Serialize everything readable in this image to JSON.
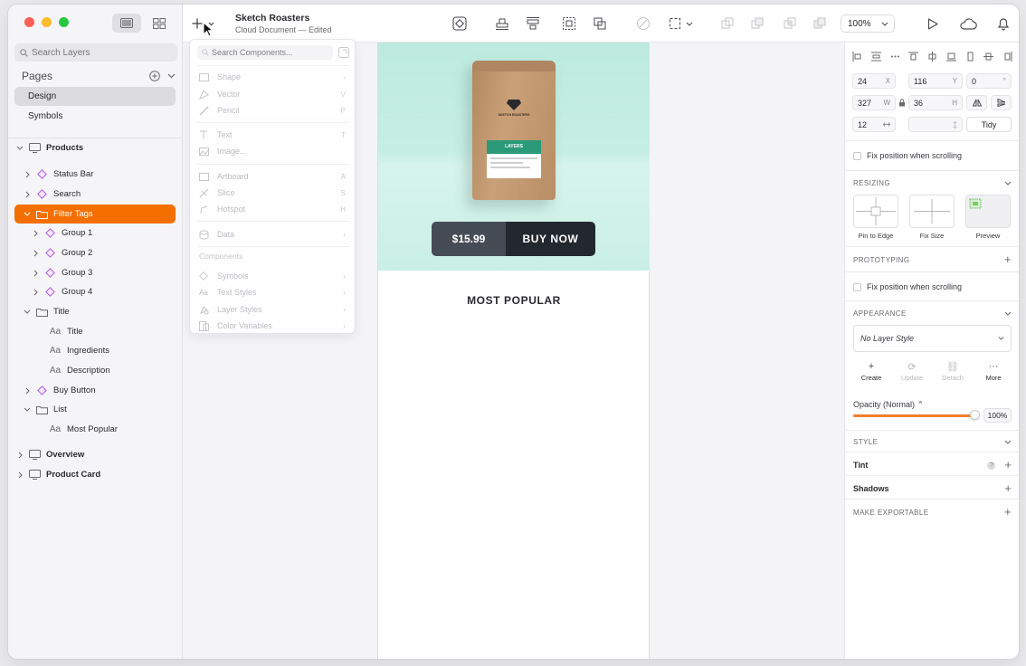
{
  "app": {
    "doc_name": "Sketch Roasters",
    "doc_status": "Cloud Document — Edited",
    "zoom": "100%"
  },
  "sidebar": {
    "search_placeholder": "Search Layers",
    "pages_label": "Pages",
    "pages": [
      {
        "label": "Design",
        "selected": true
      },
      {
        "label": "Symbols",
        "selected": false
      }
    ],
    "layers": [
      {
        "label": "Products",
        "kind": "artboard"
      },
      {
        "label": "Status Bar",
        "kind": "symbol"
      },
      {
        "label": "Search",
        "kind": "symbol"
      },
      {
        "label": "Filter Tags",
        "kind": "group",
        "selected": true
      },
      {
        "label": "Group 1",
        "kind": "symbol"
      },
      {
        "label": "Group 2",
        "kind": "symbol"
      },
      {
        "label": "Group 3",
        "kind": "symbol"
      },
      {
        "label": "Group 4",
        "kind": "symbol"
      },
      {
        "label": "Title",
        "kind": "group"
      },
      {
        "label": "Title",
        "kind": "text"
      },
      {
        "label": "Ingredients",
        "kind": "text"
      },
      {
        "label": "Description",
        "kind": "text"
      },
      {
        "label": "Buy Button",
        "kind": "symbol"
      },
      {
        "label": "List",
        "kind": "group"
      },
      {
        "label": "Most Popular",
        "kind": "text"
      },
      {
        "label": "Overview",
        "kind": "artboard"
      },
      {
        "label": "Product Card",
        "kind": "artboard"
      }
    ],
    "text_glyph": "Aa"
  },
  "insert_menu": {
    "search_placeholder": "Search Components...",
    "items": [
      {
        "label": "Shape",
        "shortcut": "›"
      },
      {
        "label": "Vector",
        "shortcut": "V"
      },
      {
        "label": "Pencil",
        "shortcut": "P"
      },
      {
        "label": "Text",
        "shortcut": "T"
      },
      {
        "label": "Image...",
        "shortcut": ""
      },
      {
        "label": "Artboard",
        "shortcut": "A"
      },
      {
        "label": "Slice",
        "shortcut": "S"
      },
      {
        "label": "Hotspot",
        "shortcut": "H"
      },
      {
        "label": "Data",
        "shortcut": "›"
      }
    ],
    "components_label": "Components",
    "component_items": [
      {
        "label": "Symbols",
        "shortcut": "›"
      },
      {
        "label": "Text Styles",
        "shortcut": "›"
      },
      {
        "label": "Layer Styles",
        "shortcut": "›"
      },
      {
        "label": "Color Variables",
        "shortcut": "›"
      }
    ]
  },
  "artboard": {
    "bag_brand": "SKETCH ROASTERS",
    "bag_label": "LAYERS",
    "price": "$15.99",
    "buy_label": "BUY NOW",
    "section_title": "MOST POPULAR",
    "hero_color": "#c6efe4",
    "button_dark": "#23272e"
  },
  "inspector": {
    "x": "24",
    "x_unit": "X",
    "y": "116",
    "y_unit": "Y",
    "rotation": "0",
    "rotation_unit": "°",
    "w": "327",
    "w_unit": "W",
    "h": "36",
    "h_unit": "H",
    "spacing": "12",
    "tidy_label": "Tidy",
    "fix_position": "Fix position when scrolling",
    "resizing_label": "RESIZING",
    "pin_to_edge": "Pin to Edge",
    "fix_size": "Fix Size",
    "preview": "Preview",
    "prototyping_label": "PROTOTYPING",
    "proto_fix_position": "Fix position when scrolling",
    "appearance_label": "APPEARANCE",
    "layer_style": "No Layer Style",
    "create": "Create",
    "update": "Update",
    "detach": "Detach",
    "more": "More",
    "opacity_label": "Opacity (Normal) ⌃",
    "opacity_value": "100%",
    "opacity": 1.0,
    "style_label": "STYLE",
    "tint_label": "Tint",
    "tint_help": "?",
    "shadows_label": "Shadows",
    "export_label": "MAKE EXPORTABLE",
    "accent": "#f46f00"
  }
}
